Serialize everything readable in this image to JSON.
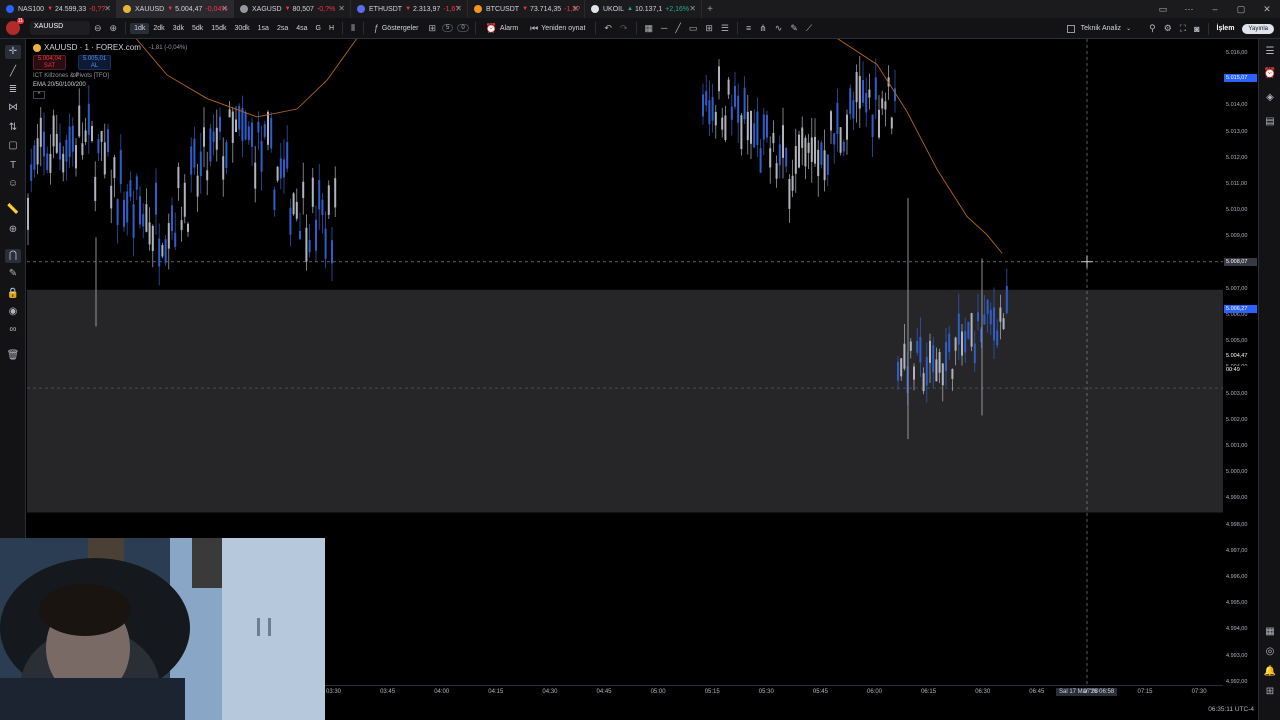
{
  "tabs": [
    {
      "symbol": "NAS100",
      "price": "24.599,33",
      "change": "-0,??",
      "dir": "down",
      "fav_color": "#2962ff"
    },
    {
      "symbol": "XAUUSD",
      "price": "5.004,47",
      "change": "-0,04%",
      "dir": "down",
      "fav_color": "#e7b33b",
      "active": true
    },
    {
      "symbol": "XAGUSD",
      "price": "80,507",
      "change": "-0,?%",
      "dir": "down",
      "fav_color": "#9598a1"
    },
    {
      "symbol": "ETHUSDT",
      "price": "2.313,97",
      "change": "-1,6?",
      "dir": "down",
      "fav_color": "#5b6dee"
    },
    {
      "symbol": "BTCUSDT",
      "price": "73.714,35",
      "change": "-1,5?",
      "dir": "down",
      "fav_color": "#f7931a"
    },
    {
      "symbol": "UKOIL",
      "price": "10.137,1",
      "change": "+2,16%",
      "dir": "up",
      "fav_color": "#e0e3eb"
    }
  ],
  "toolbar": {
    "symbol": "XAUUSD",
    "timeframes": [
      "1dk",
      "2dk",
      "3dk",
      "5dk",
      "15dk",
      "30dk",
      "1sa",
      "2sa",
      "4sa",
      "G",
      "H"
    ],
    "active_timeframe": "1dk",
    "indicators_label": "Göstergeler",
    "indicator_count_a": "5",
    "indicator_count_b": "0",
    "alarm_label": "Alarm",
    "replay_label": "Yeniden oynat",
    "tech_analysis_label": "Teknik Analiz",
    "trade_label": "İşlem",
    "publish_label": "Yayınla",
    "notif_count": "11"
  },
  "legend": {
    "title": "XAUUSD · 1 · FOREX.com",
    "ohlc_change": "-1,81 (-0,04%)",
    "sell_price": "5.004,04",
    "sell_label": "SAT",
    "buy_price": "5.005,01",
    "buy_label": "AL",
    "spread": "97",
    "indicator_1": "ICT Killzones & Pivots [TFO]",
    "indicator_2": "EMA 20/50/100/200"
  },
  "price_axis": {
    "labels": [
      "5.016,00",
      "5.015,00",
      "5.014,00",
      "5.013,00",
      "5.012,00",
      "5.011,00",
      "5.010,00",
      "5.009,00",
      "5.008,00",
      "5.007,00",
      "5.006,00",
      "5.005,00",
      "5.004,00",
      "5.003,00",
      "5.002,00",
      "5.001,00",
      "5.000,00",
      "4.999,00",
      "4.998,00",
      "4.997,00",
      "4.996,00",
      "4.995,00",
      "4.994,00",
      "4.993,00",
      "4.992,00"
    ],
    "tag_ema": "5.015,07",
    "tag_crosshair": "5.008,07",
    "tag_blue": "5.006,27",
    "tag_last": "5.004,47",
    "tag_countdown": "00:49"
  },
  "time_axis": {
    "labels": [
      "03:30",
      "03:45",
      "04:00",
      "04:15",
      "04:30",
      "04:45",
      "05:00",
      "05:15",
      "05:30",
      "05:45",
      "06:00",
      "06:15",
      "06:30",
      "06:45",
      "07:00",
      "07:15",
      "07:30"
    ],
    "crosshair_label": "Sal 17 Mar '26   06:58"
  },
  "clock": "06:35:11 UTC-4",
  "colors": {
    "bull": "#2f5ec9",
    "bear": "#b0b3bb",
    "ema": "#b5651d",
    "zone": "#262628",
    "accent": "#2962ff"
  },
  "chart_data": {
    "type": "candlestick",
    "symbol": "XAUUSD",
    "interval": "1",
    "ylim": [
      4991.5,
      5016.5
    ],
    "x": [
      "03:30",
      "03:45",
      "04:00",
      "04:15",
      "04:30",
      "04:45",
      "05:00",
      "05:15",
      "05:30",
      "05:45",
      "06:00",
      "06:15",
      "06:30",
      "06:45",
      "07:00",
      "07:15",
      "07:30"
    ],
    "visible_tail_prices": [
      5012.0,
      5011.5,
      5010.8,
      5011.2,
      5012.4,
      5011.0,
      5010.2,
      5012.8,
      5013.5,
      5014.2,
      5012.0,
      5011.6,
      5013.0,
      5012.2,
      5013.8,
      5015.2,
      5016.0,
      5015.0,
      5013.5,
      5014.5,
      5013.0,
      5013.6,
      5013.0,
      5011.8,
      5010.5,
      5009.6,
      5007.8,
      5006.0,
      5005.2,
      5004.4,
      5003.6,
      5004.8,
      5004.0,
      5005.2,
      5004.6,
      5005.8,
      5006.0,
      5007.0,
      5006.2,
      5007.8,
      5008.4,
      5006.6,
      5005.0,
      5004.6,
      5004.5
    ],
    "ema_line": true,
    "zone": {
      "from": 4998.5,
      "to": 5007.0
    },
    "crosshair_price": 5008.07,
    "last_price": 5004.47
  }
}
